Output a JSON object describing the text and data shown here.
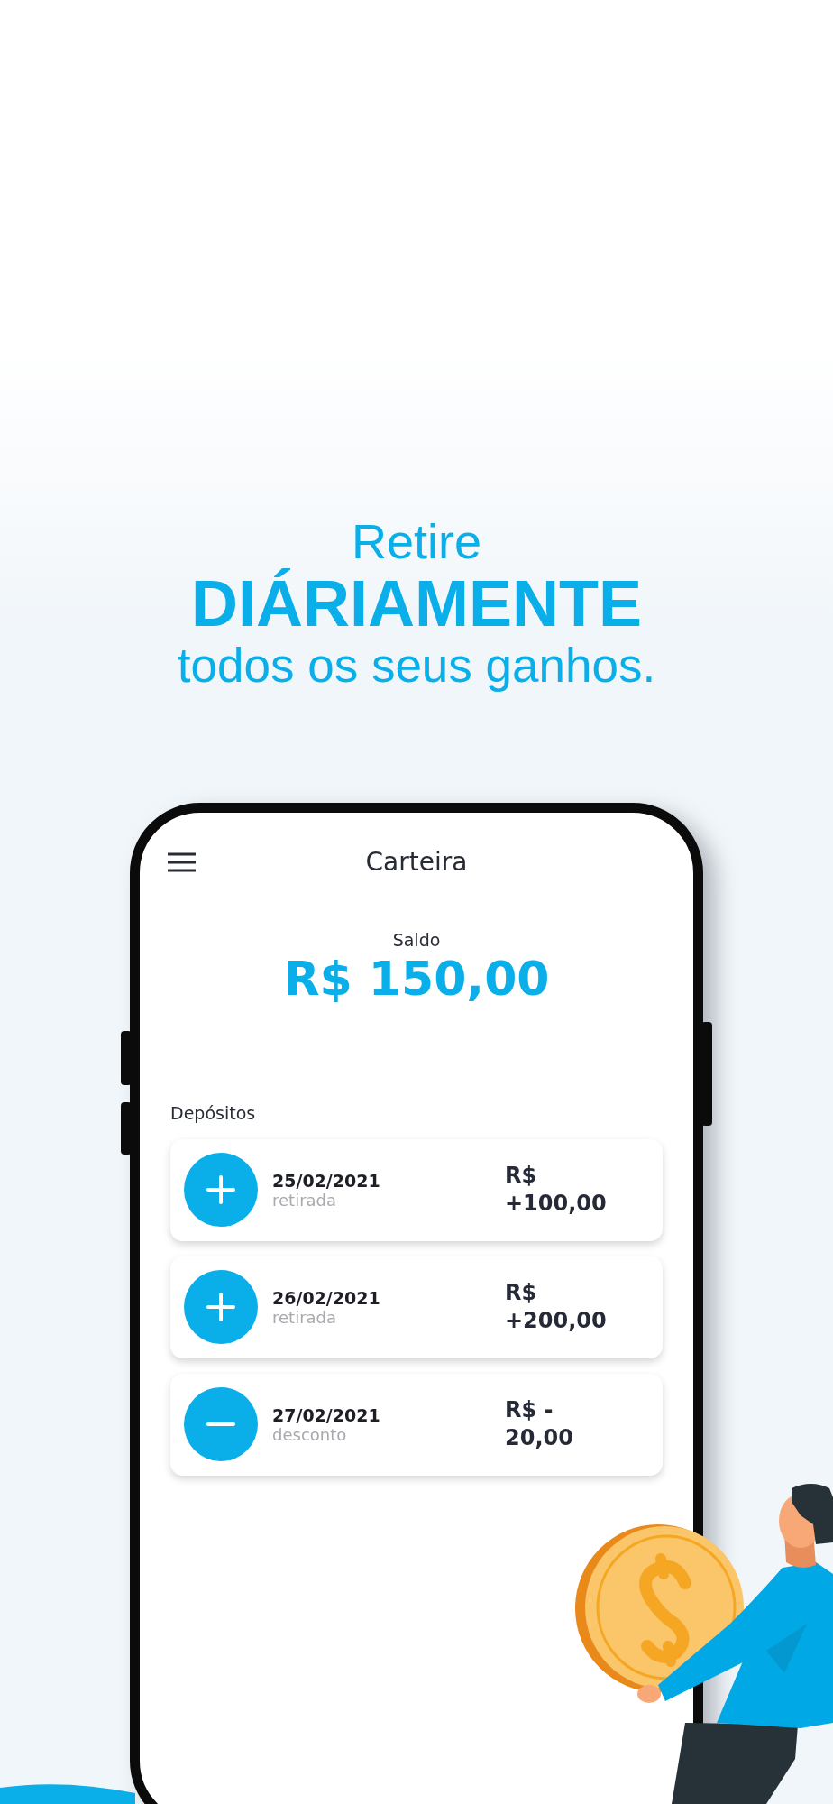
{
  "headline": {
    "line_1": "Retire",
    "line_2": "DIÁRIAMENTE",
    "line_3": "todos os seus ganhos."
  },
  "phone": {
    "app_bar": {
      "title": "Carteira"
    },
    "balance": {
      "label": "Saldo",
      "amount": "R$ 150,00"
    },
    "section_title": "Depósitos",
    "transactions": [
      {
        "kind": "credit",
        "date": "25/02/2021",
        "type_label": "retirada",
        "amount": "R$ +100,00"
      },
      {
        "kind": "credit",
        "date": "26/02/2021",
        "type_label": "retirada",
        "amount": "R$ +200,00"
      },
      {
        "kind": "debit",
        "date": "27/02/2021",
        "type_label": "desconto",
        "amount": "R$ - 20,00"
      }
    ]
  }
}
